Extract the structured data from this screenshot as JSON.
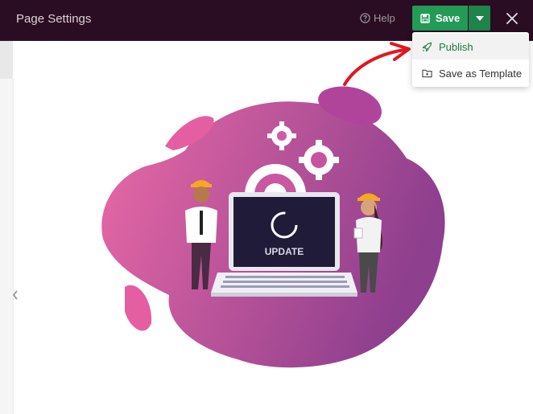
{
  "header": {
    "title": "Page Settings",
    "help_label": "Help",
    "save_label": "Save"
  },
  "save_menu": {
    "items": [
      {
        "label": "Publish",
        "icon": "rocket-icon"
      },
      {
        "label": "Save as Template",
        "icon": "folder-icon"
      }
    ]
  },
  "illustration": {
    "screen_text": "UPDATE"
  },
  "colors": {
    "topbar": "#2a0d22",
    "save_button": "#239b57",
    "blob_gradient_start": "#ea6aa6",
    "blob_gradient_end": "#8e3f8e",
    "annotation_arrow": "#e0191f"
  }
}
